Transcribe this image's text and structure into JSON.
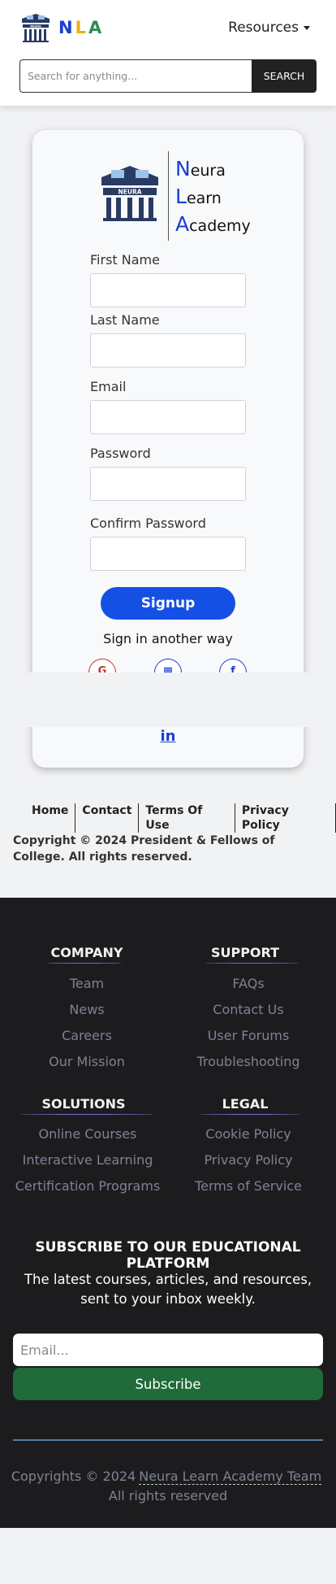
{
  "header": {
    "brand_n": "N",
    "brand_l": "L",
    "brand_a": "A",
    "resources_label": "Resources",
    "search_placeholder": "Search for anything...",
    "search_button": "SEARCH"
  },
  "card": {
    "brand_line1_first": "N",
    "brand_line1_rest": "eura",
    "brand_line2_first": "L",
    "brand_line2_rest": "earn",
    "brand_line3_first": "A",
    "brand_line3_rest": "cademy",
    "fields": {
      "first_name": "First Name",
      "last_name": "Last Name",
      "email": "Email",
      "password": "Password",
      "confirm_password": "Confirm Password"
    },
    "signup_button": "Signup",
    "signin_another": "Sign in another way",
    "linkedin_label": "in"
  },
  "footer_links": [
    "Home",
    "Contact",
    "Terms Of Use",
    "Privacy Policy"
  ],
  "copyright": "Copyright © 2024 President & Fellows of College. All rights reserved.",
  "dark_footer": {
    "company": {
      "title": "COMPANY",
      "items": [
        "Team",
        "News",
        "Careers",
        "Our Mission"
      ]
    },
    "support": {
      "title": "SUPPORT",
      "items": [
        "FAQs",
        "Contact Us",
        "User Forums",
        "Troubleshooting"
      ]
    },
    "solutions": {
      "title": "SOLUTIONS",
      "items": [
        "Online Courses",
        "Interactive Learning",
        "Certification Programs"
      ]
    },
    "legal": {
      "title": "LEGAL",
      "items": [
        "Cookie Policy",
        "Privacy Policy",
        "Terms of Service"
      ]
    },
    "subscribe_title": "SUBSCRIBE TO OUR EDUCATIONAL PLATFORM",
    "subscribe_text": "The latest courses, articles, and resources, sent to your inbox weekly.",
    "email_placeholder": "Email...",
    "subscribe_button": "Subscribe",
    "copy_prefix": "Copyrights © 2024",
    "copy_team": "Neura Learn Academy Team",
    "copy_suffix": "All rights reserved"
  },
  "colors": {
    "brand_blue": "#1a3fd4",
    "brand_yellow": "#e8b100",
    "brand_green": "#2e8b57",
    "signup_blue": "#1450e4",
    "subscribe_green": "#1f6b39",
    "footer_dark": "#1c1c1e"
  }
}
